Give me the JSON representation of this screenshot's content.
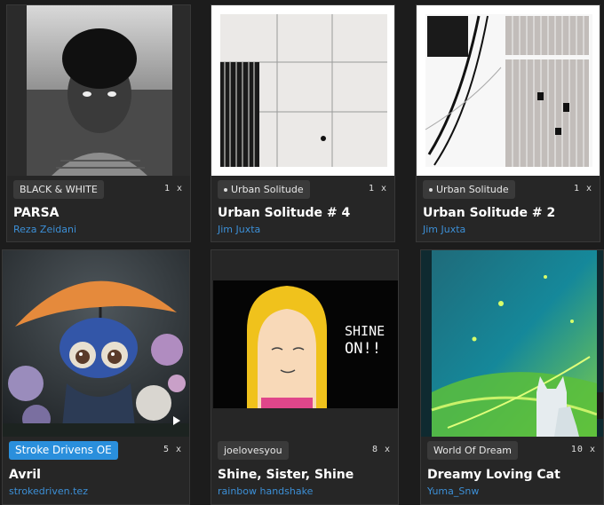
{
  "cards": [
    {
      "badge": "BLACK & WHITE",
      "editions": "1 x",
      "title": "PARSA",
      "artist": "Reza Zeidani"
    },
    {
      "badge": "Urban Solitude",
      "editions": "1 x",
      "title": "Urban Solitude # 4",
      "artist": "Jim Juxta"
    },
    {
      "badge": "Urban Solitude",
      "editions": "1 x",
      "title": "Urban Solitude # 2",
      "artist": "Jim Juxta"
    },
    {
      "badge": "Stroke Drivens OE",
      "editions": "5 x",
      "title": "Avril",
      "artist": "strokedriven.tez"
    },
    {
      "badge": "joelovesyou",
      "editions": "8 x",
      "title": "Shine, Sister, Shine",
      "artist": "rainbow handshake"
    },
    {
      "badge": "World Of Dream",
      "editions": "10 x",
      "title": "Dreamy Loving Cat",
      "artist": "Yuma_Snw"
    }
  ],
  "artwork_text": {
    "shine": "SHINE",
    "on": "ON!!"
  },
  "colors": {
    "background": "#1c1c1c",
    "card": "#262626",
    "link": "#3c8fd6",
    "accent_badge": "#2a8fdc"
  }
}
